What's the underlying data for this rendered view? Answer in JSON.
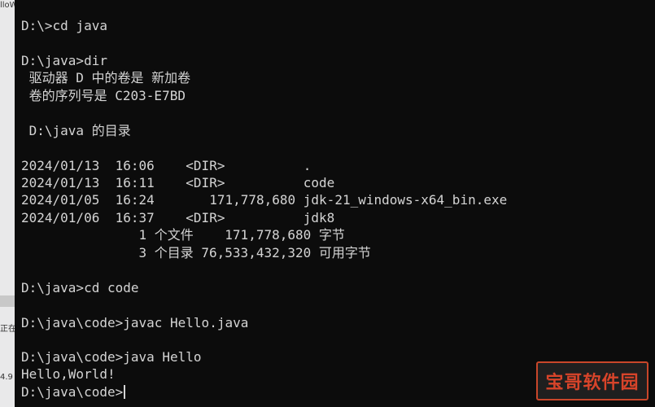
{
  "left_strip": {
    "top_tab": "lloW",
    "marker_a": "正在",
    "marker_b": "4.9"
  },
  "terminal": {
    "lines": [
      "D:\\>cd java",
      "",
      "D:\\java>dir",
      " 驱动器 D 中的卷是 新加卷",
      " 卷的序列号是 C203-E7BD",
      "",
      " D:\\java 的目录",
      "",
      "2024/01/13  16:06    <DIR>          .",
      "2024/01/13  16:11    <DIR>          code",
      "2024/01/05  16:24       171,778,680 jdk-21_windows-x64_bin.exe",
      "2024/01/06  16:37    <DIR>          jdk8",
      "               1 个文件    171,778,680 字节",
      "               3 个目录 76,533,432,320 可用字节",
      "",
      "D:\\java>cd code",
      "",
      "D:\\java\\code>javac Hello.java",
      "",
      "D:\\java\\code>java Hello",
      "Hello,World!",
      "D:\\java\\code>"
    ]
  },
  "watermark": {
    "text": "宝哥软件园",
    "color": "#d8442a"
  }
}
